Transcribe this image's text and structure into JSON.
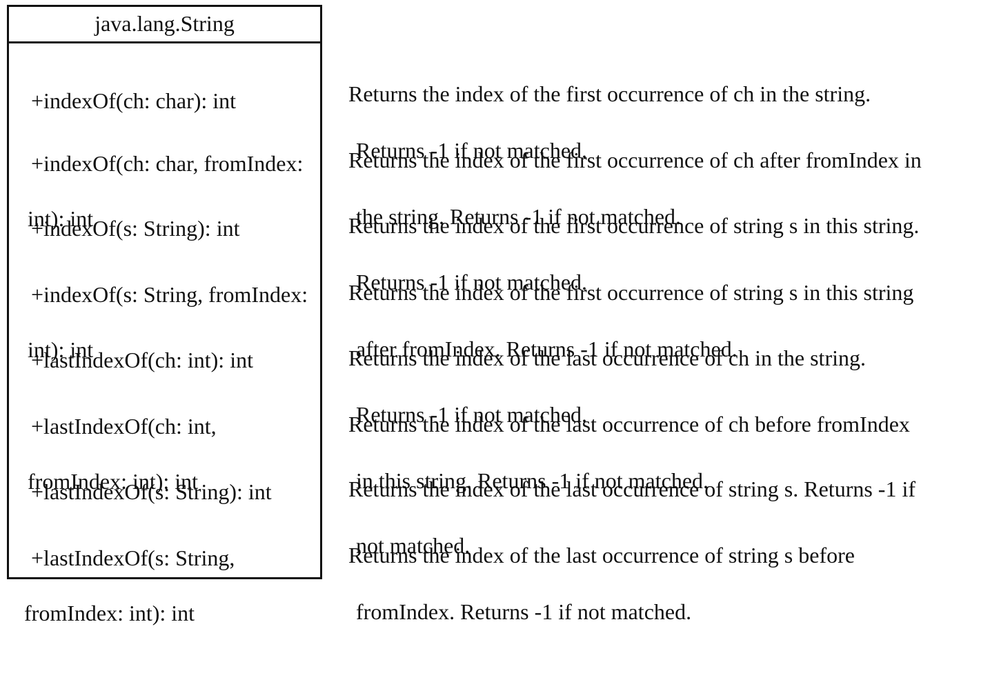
{
  "class_name": "java.lang.String",
  "methods": [
    {
      "line1": "+indexOf(ch: char): int",
      "line2": ""
    },
    {
      "line1": "+indexOf(ch: char, fromIndex:",
      "line2": "int): int"
    },
    {
      "line1": "+indexOf(s: String): int",
      "line2": ""
    },
    {
      "line1": "+indexOf(s: String, fromIndex:",
      "line2": "int): int"
    },
    {
      "line1": "+lastIndexOf(ch: int): int",
      "line2": ""
    },
    {
      "line1": "+lastIndexOf(ch: int,",
      "line2": "fromIndex: int): int"
    },
    {
      "line1": "+lastIndexOf(s: String): int",
      "line2": ""
    },
    {
      "line1": "+lastIndexOf(s: String,",
      "line2": "fromIndex: int): int"
    }
  ],
  "descriptions": [
    {
      "line1": "Returns the index of the first occurrence of ch in the string.",
      "line2": "Returns -1 if not matched."
    },
    {
      "line1": "Returns the index of the first occurrence of ch after fromIndex in",
      "line2": "the string. Returns -1 if not matched."
    },
    {
      "line1": "Returns the index of the first occurrence of string s in this string.",
      "line2": "Returns -1 if not matched."
    },
    {
      "line1": "Returns the index of the first occurrence of string s in this string",
      "line2": "after fromIndex. Returns -1 if not matched."
    },
    {
      "line1": "Returns the index of the last occurrence of ch in the string.",
      "line2": "Returns -1 if not matched."
    },
    {
      "line1": "Returns the index of the last occurrence of ch before fromIndex",
      "line2": "in this string. Returns -1 if not matched."
    },
    {
      "line1": "Returns the index of the last occurrence of string s. Returns -1 if",
      "line2": "not matched."
    },
    {
      "line1": "Returns the index of the last occurrence of string s before",
      "line2": "fromIndex. Returns -1 if not matched."
    }
  ]
}
